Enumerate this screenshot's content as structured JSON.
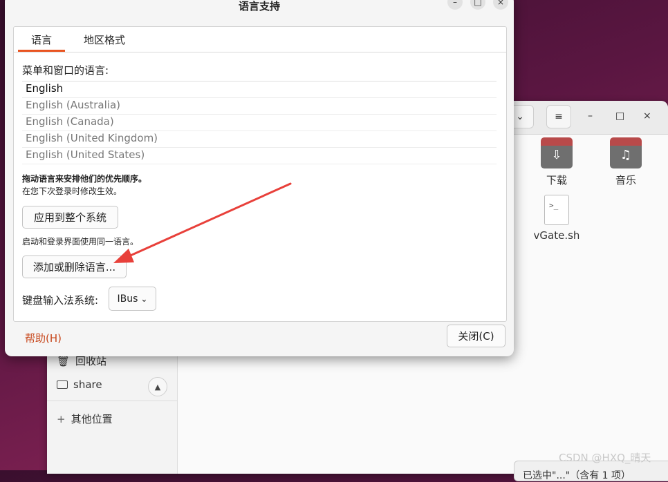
{
  "file_manager": {
    "files": [
      {
        "name": "下载",
        "icon": "download-folder-icon",
        "glyph": "⇩"
      },
      {
        "name": "音乐",
        "icon": "music-folder-icon",
        "glyph": "♫"
      },
      {
        "name": "vGate.sh",
        "icon": "script-file-icon",
        "glyph": ">_"
      }
    ],
    "sidebar": {
      "trash": "回收站",
      "share": "share",
      "other_locations": "其他位置",
      "add_symbol": "+"
    },
    "status": "已选中\"...\"（含有 1 项）",
    "window_controls": {
      "minimize": "–",
      "maximize": "□",
      "close": "×"
    },
    "header": {
      "list_symbol": "≡",
      "dropdown_symbol": "⌄"
    }
  },
  "dialog": {
    "title": "语言支持",
    "tabs": [
      "语言",
      "地区格式"
    ],
    "menu_language_label": "菜单和窗口的语言:",
    "languages": [
      "English",
      "English (Australia)",
      "English (Canada)",
      "English (United Kingdom)",
      "English (United States)"
    ],
    "drag_hint": "拖动语言来安排他们的优先顺序。",
    "relogin_hint": "在您下次登录时修改生效。",
    "apply_button": "应用到整个系统",
    "apply_hint": "启动和登录界面使用同一语言。",
    "add_remove_button": "添加或删除语言...",
    "input_method_label": "键盘输入法系统:",
    "input_method_value": "IBus",
    "help_button": "帮助(H)",
    "close_button": "关闭(C)",
    "window_controls": {
      "minimize": "–",
      "maximize": "□",
      "close": "×"
    }
  },
  "annotation": {
    "color": "#e8403a"
  },
  "watermark": "CSDN @HXQ_晴天",
  "colors": {
    "accent": "#e95420",
    "help_text": "#c7461b"
  }
}
